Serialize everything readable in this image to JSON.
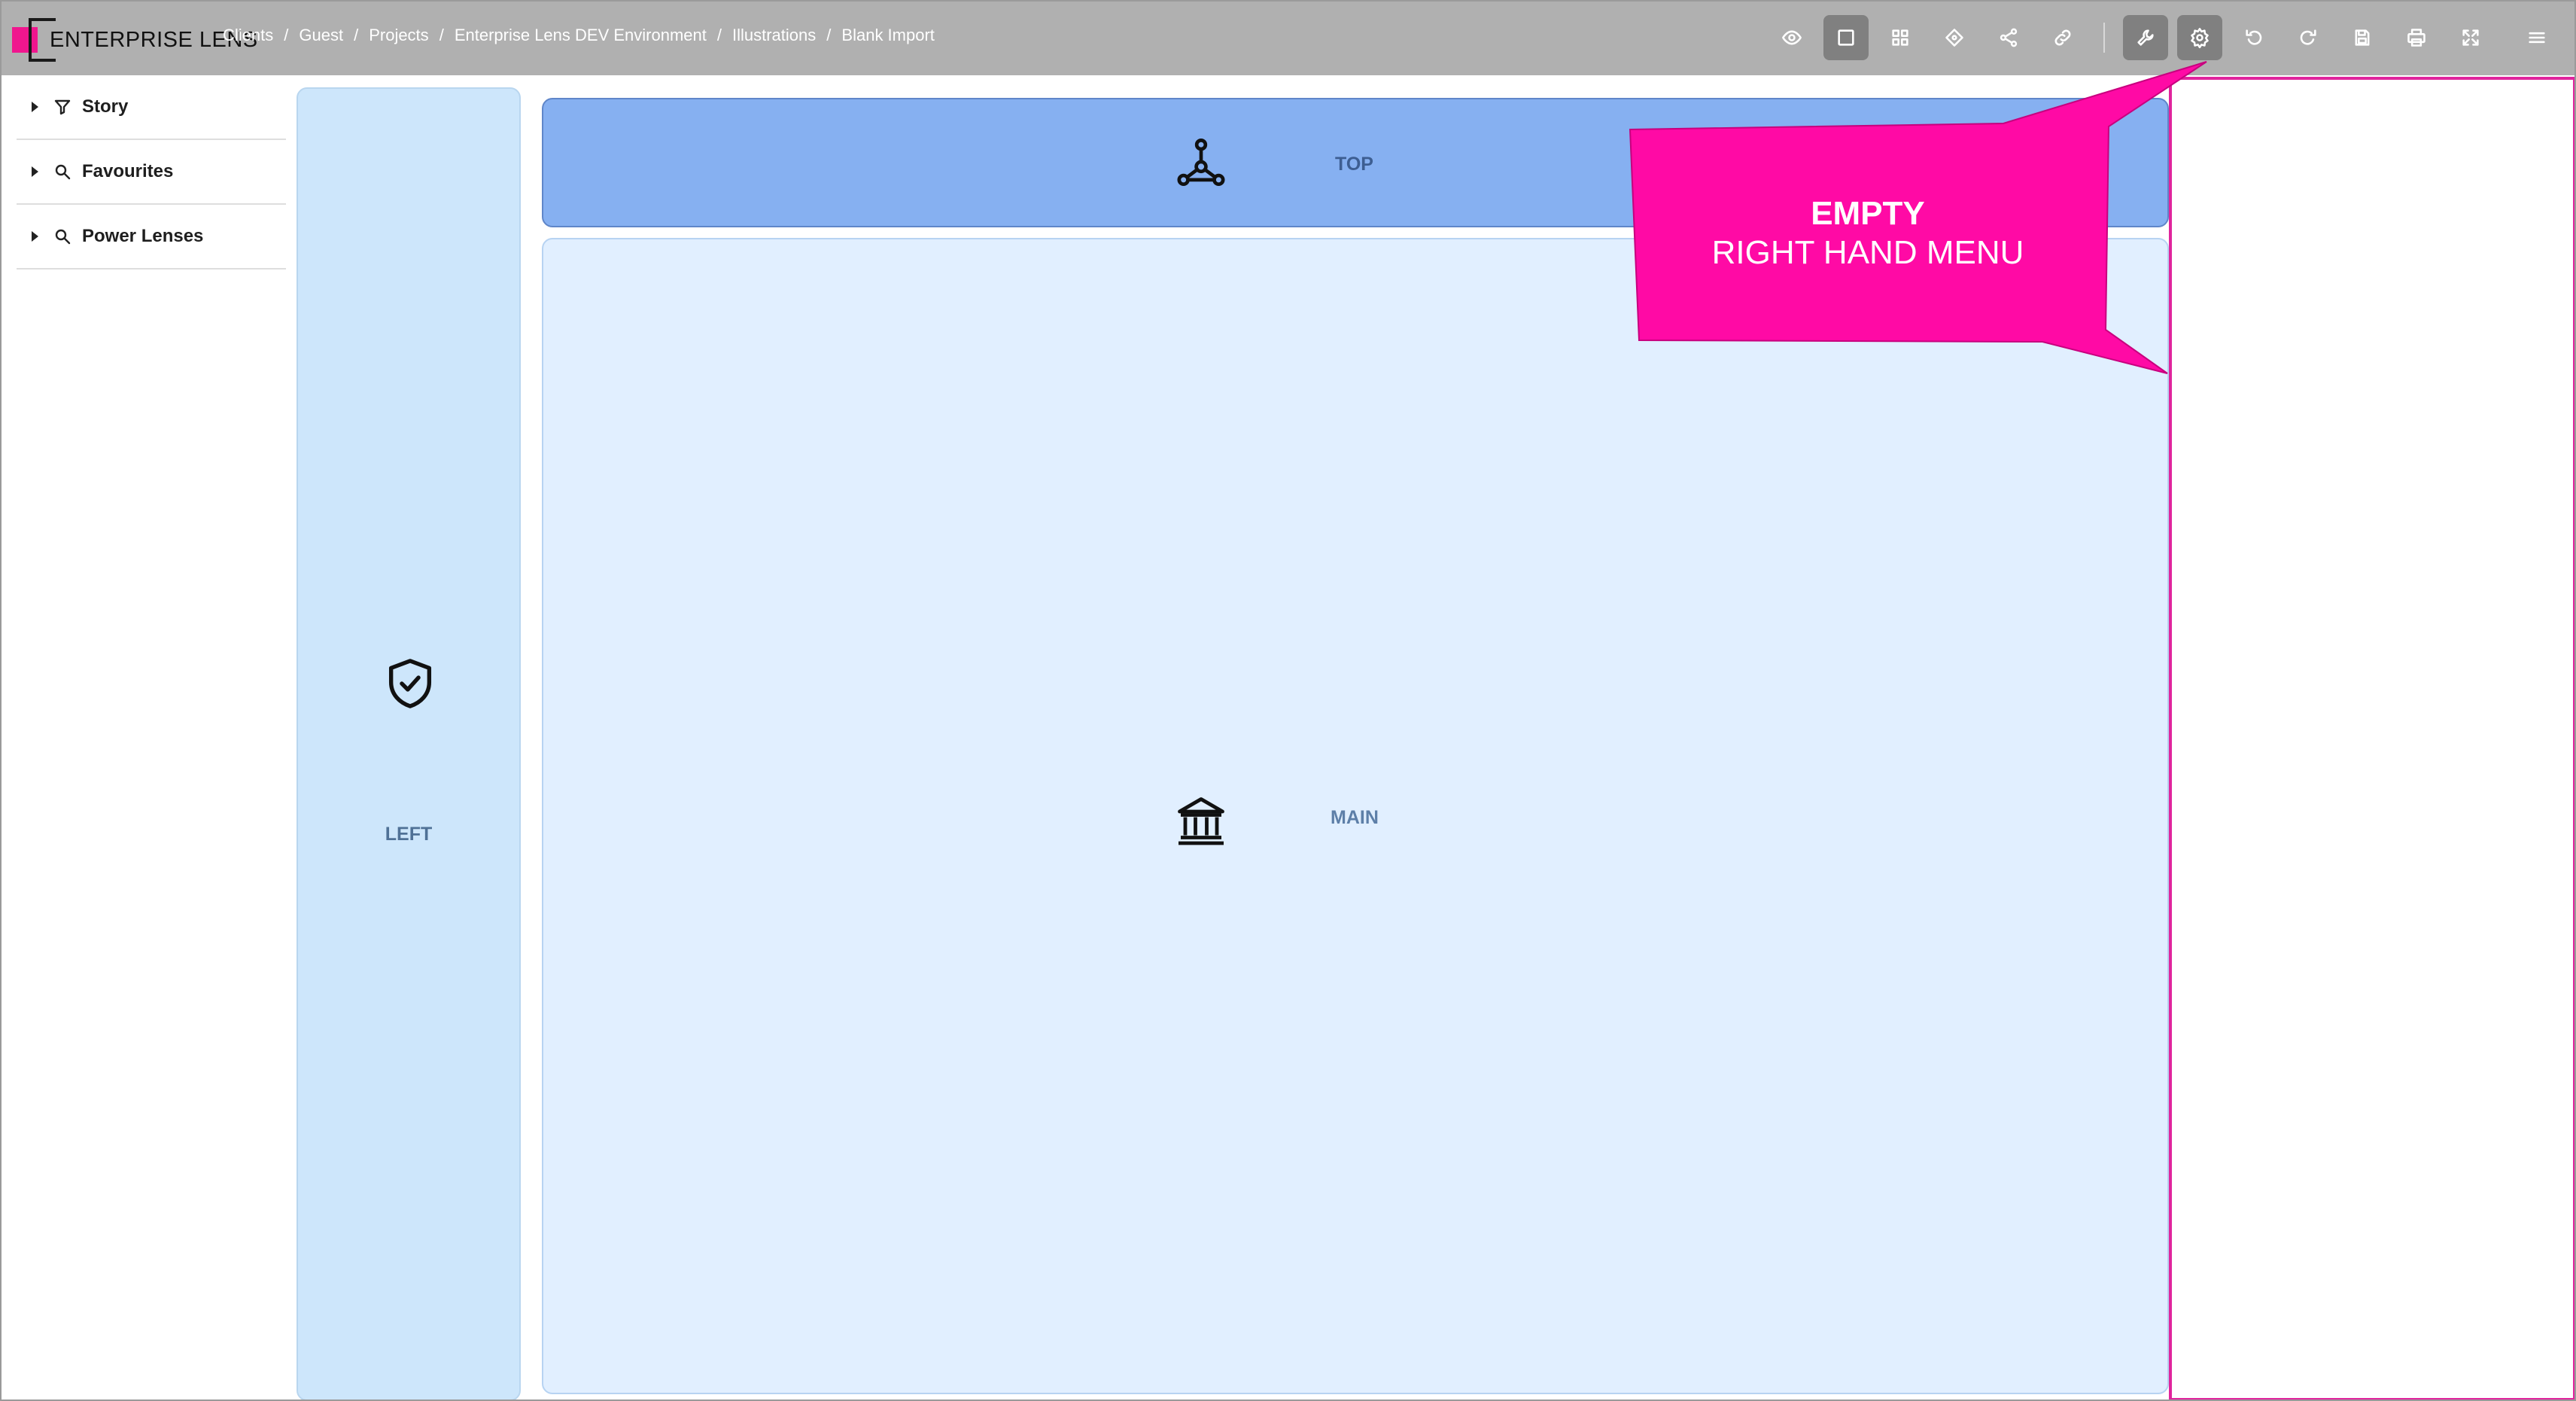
{
  "app": {
    "logo_text": "ENTERPRISE LENS",
    "brand_color": "#f0168e"
  },
  "breadcrumb": [
    "Clients",
    "Guest",
    "Projects",
    "Enterprise Lens DEV Environment",
    "Illustrations",
    "Blank Import"
  ],
  "breadcrumb_separator": "/",
  "toolbar": {
    "buttons": [
      {
        "icon": "eye-icon",
        "active": false
      },
      {
        "icon": "square-icon",
        "active": true
      },
      {
        "icon": "grid-icon",
        "active": false
      },
      {
        "icon": "crosshair-icon",
        "active": false
      },
      {
        "icon": "share-icon",
        "active": false
      },
      {
        "icon": "link-icon",
        "active": false
      },
      {
        "icon": "wrench-icon",
        "active": true
      },
      {
        "icon": "gear-icon",
        "active": true
      },
      {
        "icon": "undo-icon",
        "active": false
      },
      {
        "icon": "redo-icon",
        "active": false
      },
      {
        "icon": "save-icon",
        "active": false
      },
      {
        "icon": "print-icon",
        "active": false
      },
      {
        "icon": "fullscreen-icon",
        "active": false
      },
      {
        "icon": "hamburger-menu-icon",
        "active": false
      }
    ]
  },
  "nav": {
    "items": [
      {
        "label": "Story",
        "icon": "filter-icon"
      },
      {
        "label": "Favourites",
        "icon": "search-icon"
      },
      {
        "label": "Power Lenses",
        "icon": "search-icon"
      }
    ]
  },
  "panels": {
    "left": {
      "label": "LEFT",
      "icon": "shield-check-icon"
    },
    "top": {
      "label": "TOP",
      "icon": "network-nodes-icon"
    },
    "main": {
      "label": "MAIN",
      "icon": "bank-building-icon"
    }
  },
  "callout": {
    "line1": "EMPTY",
    "line2": "RIGHT HAND MENU",
    "color": "#ff0aa5"
  }
}
